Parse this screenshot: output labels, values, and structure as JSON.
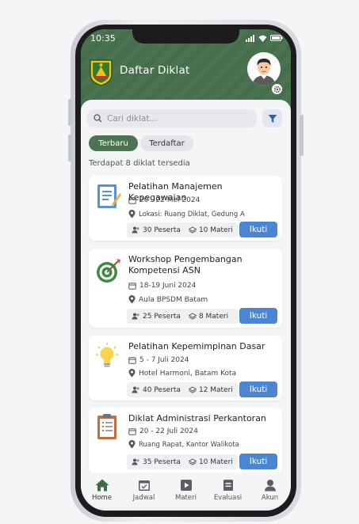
{
  "status_bar": {
    "time": "10:35"
  },
  "header": {
    "title": "Daftar Diklat"
  },
  "search": {
    "placeholder": "Cari diklat..."
  },
  "tabs": [
    {
      "label": "Terbaru",
      "active": true
    },
    {
      "label": "Terdaftar",
      "active": false
    }
  ],
  "result_count": "Terdapat 8 diklat tersedia",
  "courses": [
    {
      "title": "Pelatihan Manajemen Kepegawaian",
      "date": "20 - 22 Mei 2024",
      "location": "Lokasi: Ruang Diklat, Gedung A",
      "participants": "30 Peserta",
      "materials": "10 Materi",
      "button": "Ikuti",
      "icon": "document-edit-icon"
    },
    {
      "title": "Workshop Pengembangan Kompetensi ASN",
      "date": "18-19 Juni 2024",
      "location": "Aula BPSDM Batam",
      "participants": "25 Peserta",
      "materials": "8 Materi",
      "button": "Ikuti",
      "icon": "target-icon"
    },
    {
      "title": "Pelatihan Kepemimpinan Dasar",
      "date": "5 - 7 Juli 2024",
      "location": "Hotel Harmoni, Batam Kota",
      "participants": "40 Peserta",
      "materials": "12 Materi",
      "button": "Ikuti",
      "icon": "lightbulb-icon"
    },
    {
      "title": "Diklat Administrasi Perkantoran",
      "date": "20 - 22 Juli 2024",
      "location": "Ruang Rapat, Kantor Walikota",
      "participants": "35 Peserta",
      "materials": "10 Materi",
      "button": "Ikuti",
      "icon": "clipboard-icon"
    }
  ],
  "bottom_nav": [
    {
      "label": "Home",
      "icon": "home-icon",
      "active": true
    },
    {
      "label": "Jadwal",
      "icon": "calendar-icon",
      "active": false
    },
    {
      "label": "Materi",
      "icon": "play-icon",
      "active": false
    },
    {
      "label": "Evaluasi",
      "icon": "evaluation-icon",
      "active": false
    },
    {
      "label": "Akun",
      "icon": "user-icon",
      "active": false
    }
  ],
  "colors": {
    "header_green": "#456e4b",
    "tab_active": "#4d7452",
    "button_blue": "#4a86d1",
    "filter_icon": "#2f5fb3"
  }
}
